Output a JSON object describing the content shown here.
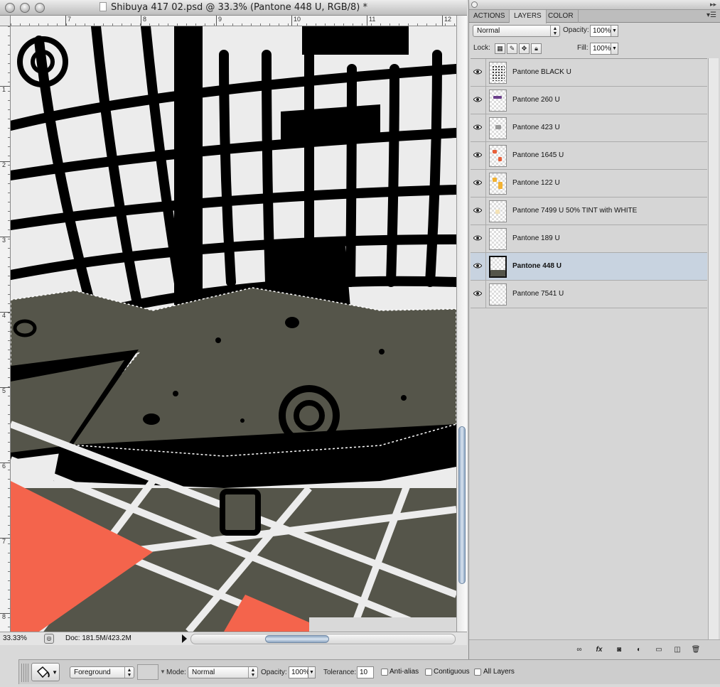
{
  "document": {
    "title": "Shibuya 417 02.psd @ 33.3% (Pantone 448 U, RGB/8) *",
    "ruler_h_ticks": [
      "7",
      "8",
      "9",
      "10",
      "11",
      "12"
    ],
    "ruler_v_ticks": [
      "1",
      "2",
      "3",
      "4",
      "5",
      "6",
      "7",
      "8"
    ],
    "status": {
      "zoom": "33.33%",
      "doc_size": "Doc: 181.5M/423.2M"
    }
  },
  "panel": {
    "tabs": [
      "ACTIONS",
      "LAYERS",
      "COLOR"
    ],
    "active_tab": "LAYERS",
    "blend_mode": "Normal",
    "opacity_label": "Opacity:",
    "opacity_value": "100%",
    "lock_label": "Lock:",
    "fill_label": "Fill:",
    "fill_value": "100%",
    "layers": [
      {
        "name": "Pantone BLACK U"
      },
      {
        "name": "Pantone 260 U"
      },
      {
        "name": "Pantone 423 U"
      },
      {
        "name": "Pantone 1645 U"
      },
      {
        "name": "Pantone 122 U"
      },
      {
        "name": "Pantone 7499 U 50% TINT with WHITE"
      },
      {
        "name": "Pantone 189 U"
      },
      {
        "name": "Pantone 448 U",
        "selected": true
      },
      {
        "name": "Pantone 7541 U"
      }
    ],
    "footer_icons": [
      "link-icon",
      "fx-icon",
      "mask-icon",
      "adjustment-icon",
      "group-folder-icon",
      "new-layer-icon",
      "trash-icon"
    ]
  },
  "options_bar": {
    "fill_source": "Foreground",
    "mode_label": "Mode:",
    "mode_value": "Normal",
    "opacity_label": "Opacity:",
    "opacity_value": "100%",
    "tolerance_label": "Tolerance:",
    "tolerance_value": "10",
    "anti_alias_label": "Anti-alias",
    "contiguous_label": "Contiguous",
    "all_layers_label": "All Layers"
  },
  "colors": {
    "artwork_black": "#000000",
    "artwork_gray": "#55554a",
    "artwork_light": "#ececec",
    "artwork_salmon": "#f4644c",
    "selection_highlight": "#c8d3e0"
  }
}
